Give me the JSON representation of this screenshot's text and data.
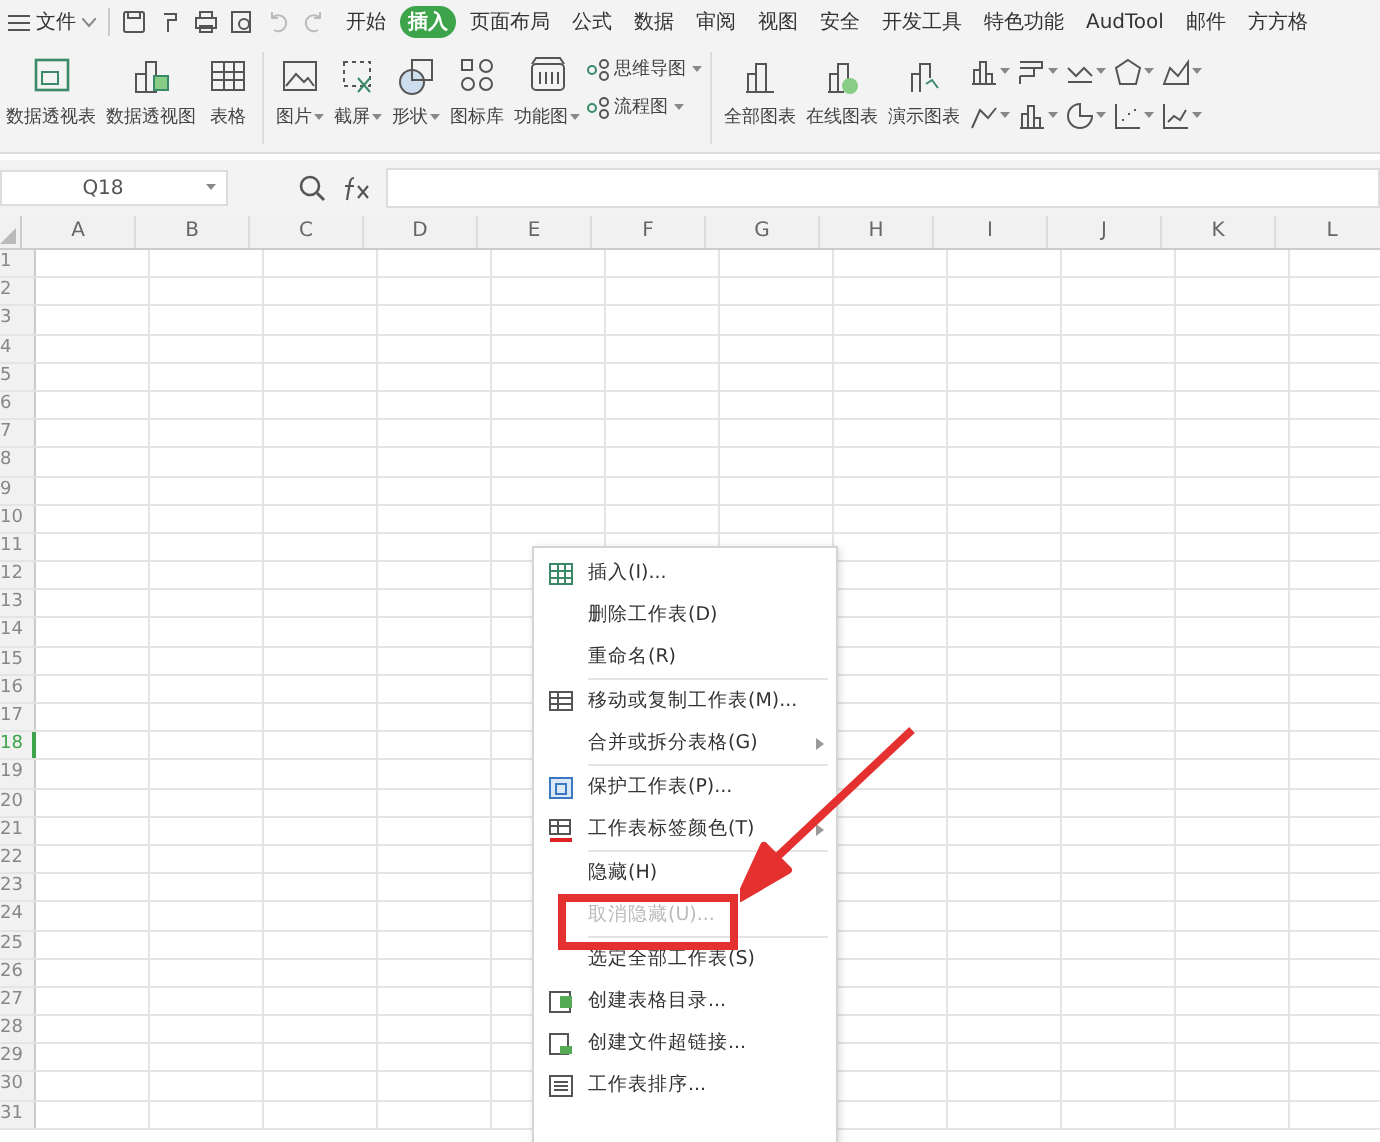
{
  "menu_bar": {
    "file_label": "文件",
    "tabs": [
      {
        "label": "开始",
        "selected": false
      },
      {
        "label": "插入",
        "selected": true
      },
      {
        "label": "页面布局",
        "selected": false
      },
      {
        "label": "公式",
        "selected": false
      },
      {
        "label": "数据",
        "selected": false
      },
      {
        "label": "审阅",
        "selected": false
      },
      {
        "label": "视图",
        "selected": false
      },
      {
        "label": "安全",
        "selected": false
      },
      {
        "label": "开发工具",
        "selected": false
      },
      {
        "label": "特色功能",
        "selected": false
      },
      {
        "label": "AudTool",
        "selected": false
      },
      {
        "label": "邮件",
        "selected": false
      },
      {
        "label": "方方格",
        "selected": false
      }
    ]
  },
  "ribbon": {
    "groups": [
      {
        "buttons": [
          {
            "label": "数据透视表",
            "dropdown": false
          },
          {
            "label": "数据透视图",
            "dropdown": false
          },
          {
            "label": "表格",
            "dropdown": false
          }
        ]
      },
      {
        "buttons": [
          {
            "label": "图片",
            "dropdown": true
          },
          {
            "label": "截屏",
            "dropdown": true
          },
          {
            "label": "形状",
            "dropdown": true
          },
          {
            "label": "图标库",
            "dropdown": false
          },
          {
            "label": "功能图",
            "dropdown": true
          }
        ],
        "small_buttons": [
          {
            "label": "思维导图",
            "dropdown": true
          },
          {
            "label": "流程图",
            "dropdown": true
          }
        ]
      },
      {
        "buttons": [
          {
            "label": "全部图表",
            "dropdown": false
          },
          {
            "label": "在线图表",
            "dropdown": false
          },
          {
            "label": "演示图表",
            "dropdown": false
          }
        ]
      }
    ]
  },
  "formula_bar": {
    "name_box": "Q18"
  },
  "sheet": {
    "columns": [
      "A",
      "B",
      "C",
      "D",
      "E",
      "F",
      "G",
      "H",
      "I",
      "J",
      "K",
      "L"
    ],
    "rows": [
      {
        "label": "1",
        "selected": false
      },
      {
        "label": "2",
        "selected": false
      },
      {
        "label": "3",
        "selected": false
      },
      {
        "label": "4",
        "selected": false
      },
      {
        "label": "5",
        "selected": false
      },
      {
        "label": "6",
        "selected": false
      },
      {
        "label": "7",
        "selected": false
      },
      {
        "label": "8",
        "selected": false
      },
      {
        "label": "9",
        "selected": false
      },
      {
        "label": "10",
        "selected": false
      },
      {
        "label": "11",
        "selected": false
      },
      {
        "label": "12",
        "selected": false
      },
      {
        "label": "13",
        "selected": false
      },
      {
        "label": "14",
        "selected": false
      },
      {
        "label": "15",
        "selected": false
      },
      {
        "label": "16",
        "selected": false
      },
      {
        "label": "17",
        "selected": false
      },
      {
        "label": "18",
        "selected": true
      },
      {
        "label": "19",
        "selected": false
      },
      {
        "label": "20",
        "selected": false
      },
      {
        "label": "21",
        "selected": false
      },
      {
        "label": "22",
        "selected": false
      },
      {
        "label": "23",
        "selected": false
      },
      {
        "label": "24",
        "selected": false
      },
      {
        "label": "25",
        "selected": false
      },
      {
        "label": "26",
        "selected": false
      },
      {
        "label": "27",
        "selected": false
      },
      {
        "label": "28",
        "selected": false
      },
      {
        "label": "29",
        "selected": false
      },
      {
        "label": "30",
        "selected": false
      },
      {
        "label": "31",
        "selected": false
      }
    ]
  },
  "context_menu": {
    "items": [
      {
        "label": "插入(I)...",
        "kind": "insert",
        "disabled": false,
        "submenu": false,
        "divider_before": false
      },
      {
        "label": "删除工作表(D)",
        "kind": "plain",
        "disabled": false,
        "submenu": false,
        "divider_before": false
      },
      {
        "label": "重命名(R)",
        "kind": "plain",
        "disabled": false,
        "submenu": false,
        "divider_before": false
      },
      {
        "label": "移动或复制工作表(M)...",
        "kind": "move",
        "disabled": false,
        "submenu": false,
        "divider_before": true
      },
      {
        "label": "合并或拆分表格(G)",
        "kind": "plain",
        "disabled": false,
        "submenu": true,
        "divider_before": false
      },
      {
        "label": "保护工作表(P)...",
        "kind": "protect",
        "disabled": false,
        "submenu": false,
        "divider_before": true
      },
      {
        "label": "工作表标签颜色(T)",
        "kind": "tab_color",
        "disabled": false,
        "submenu": true,
        "divider_before": false
      },
      {
        "label": "隐藏(H)",
        "kind": "plain",
        "disabled": false,
        "submenu": false,
        "divider_before": true
      },
      {
        "label": "取消隐藏(U)...",
        "kind": "plain",
        "disabled": true,
        "submenu": false,
        "divider_before": false
      },
      {
        "label": "选定全部工作表(S)",
        "kind": "plain",
        "disabled": false,
        "submenu": false,
        "divider_before": true
      },
      {
        "label": "创建表格目录...",
        "kind": "catalog",
        "disabled": false,
        "submenu": false,
        "divider_before": false
      },
      {
        "label": "创建文件超链接...",
        "kind": "link",
        "disabled": false,
        "submenu": false,
        "divider_before": false
      },
      {
        "label": "工作表排序...",
        "kind": "sort",
        "disabled": false,
        "submenu": false,
        "divider_before": false
      }
    ]
  }
}
